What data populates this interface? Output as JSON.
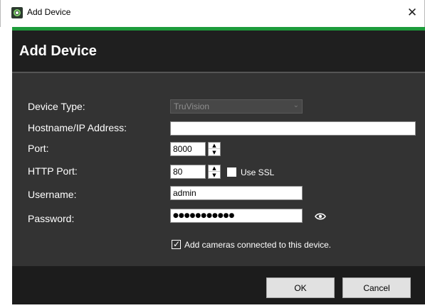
{
  "window": {
    "title": "Add Device",
    "close_glyph": "✕"
  },
  "dialog": {
    "heading": "Add Device"
  },
  "form": {
    "device_type": {
      "label": "Device Type:",
      "value": "TruVision"
    },
    "hostname": {
      "label": "Hostname/IP Address:",
      "value": ""
    },
    "port": {
      "label": "Port:",
      "value": "8000"
    },
    "http_port": {
      "label": "HTTP Port:",
      "value": "80"
    },
    "use_ssl": {
      "label": "Use SSL",
      "checked": false
    },
    "username": {
      "label": "Username:",
      "value": "admin"
    },
    "password": {
      "label": "Password:",
      "value": "●●●●●●●●●●●"
    },
    "add_cameras": {
      "label": "Add cameras connected to this device.",
      "checked": true
    }
  },
  "buttons": {
    "ok": "OK",
    "cancel": "Cancel"
  },
  "icons": {
    "app": "truvision-app-icon",
    "reveal": "eye-icon",
    "spin_up": "▲",
    "spin_down": "▼",
    "dropdown": "⌄",
    "check": "✓"
  },
  "colors": {
    "accent": "#1d9b3b",
    "dialog_bg": "#333333",
    "header_bg": "#1f1f1f",
    "footer_bg": "#1c1c1c"
  }
}
